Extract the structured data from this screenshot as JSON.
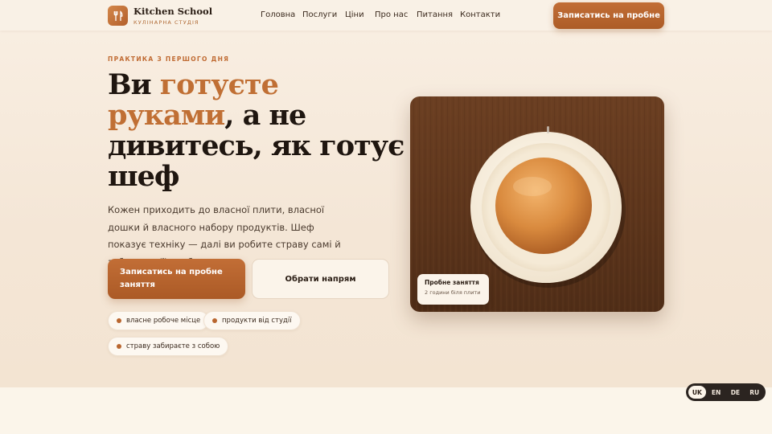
{
  "brand": {
    "name": "Kitchen School",
    "subtitle": "КУЛІНАРНА СТУДІЯ",
    "logo_icon": "fork-knife-icon",
    "accent_color": "#b9662f"
  },
  "nav": {
    "items": [
      "Головна",
      "Послуги",
      "Ціни",
      "Про нас",
      "Питання",
      "Контакти"
    ]
  },
  "header_cta": "Записатись на пробне",
  "hero": {
    "eyebrow": "ПРАКТИКА З ПЕРШОГО ДНЯ",
    "headline": {
      "part1": "Ви ",
      "accent1": "готуєте",
      "accent2": "руками",
      "part2": ", а не дивитесь, як готує шеф"
    },
    "lead": "Кожен приходить до власної плити, власної дошки й власного набору продуктів. Шеф показує техніку — далі ви робите страву самі й забираєте її з собою.",
    "primary_button": "Записатись на пробне заняття",
    "secondary_button": "Обрати напрям",
    "chips": [
      "власне робоче місце",
      "продукти від студії",
      "страву забираєте з собою"
    ]
  },
  "photo_card": {
    "title": "Пробне заняття",
    "subtitle": "2 години біля плити"
  },
  "languages": {
    "items": [
      "UK",
      "EN",
      "DE",
      "RU"
    ],
    "active": "UK"
  }
}
